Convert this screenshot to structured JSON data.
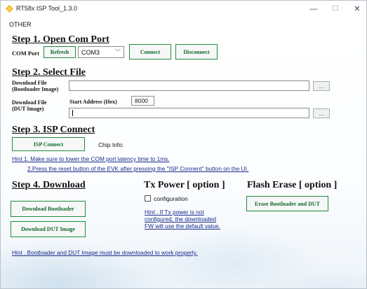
{
  "window": {
    "title": "RT58x ISP Tool_1.3.0",
    "controls": {
      "minimize": "—",
      "maximize": "☐",
      "close": "✕"
    }
  },
  "menu": {
    "items": [
      "OTHER"
    ]
  },
  "step1": {
    "heading": "Step 1. Open Com Port",
    "com_port_label": "COM Port",
    "refresh_label": "Refresh",
    "com_port_value": "COM3",
    "connect_label": "Connect",
    "disconnect_label": "Disconnect"
  },
  "step2": {
    "heading": "Step 2. Select File",
    "bootloader_label_line1": "Download File",
    "bootloader_label_line2": "(Bootloader Image)",
    "bootloader_path": "",
    "browse_label": "...",
    "dut_label_line1": "Download File",
    "dut_label_line2": "(DUT Image)",
    "start_address_label": "Start Address (Hex)",
    "start_address_value": "8000",
    "dut_path": ""
  },
  "step3": {
    "heading": "Step 3. ISP Connect",
    "isp_connect_label": "ISP Connect",
    "chip_info_label": "Chip Info:",
    "hint1": "Hint 1. Make sure to lower the COM port latency time to 1ms.",
    "hint2": "2.Press the reset button of the EVK after pressing the \"ISP Connent\" button on the UI."
  },
  "step4": {
    "heading": "Step 4. Download",
    "download_bootloader_label": "Download Bootloader",
    "download_dut_label": "Download DUT Image"
  },
  "tx_power": {
    "heading": "Tx Power [ option ]",
    "configuration_label": "configuration",
    "configuration_checked": false,
    "hint": "Hint . If Tx power is not configured, the downloaded FW will use the default value."
  },
  "flash_erase": {
    "heading": "Flash Erase [ option ]",
    "erase_label": "Erase Bootloader and DUT"
  },
  "footer_hint": "Hint . Bootloader and DUT Image must be downloaded to work properly.",
  "colors": {
    "button_border": "#1f8a3c",
    "button_text": "#0f6a2c",
    "hint_text": "#1b2c8a"
  }
}
